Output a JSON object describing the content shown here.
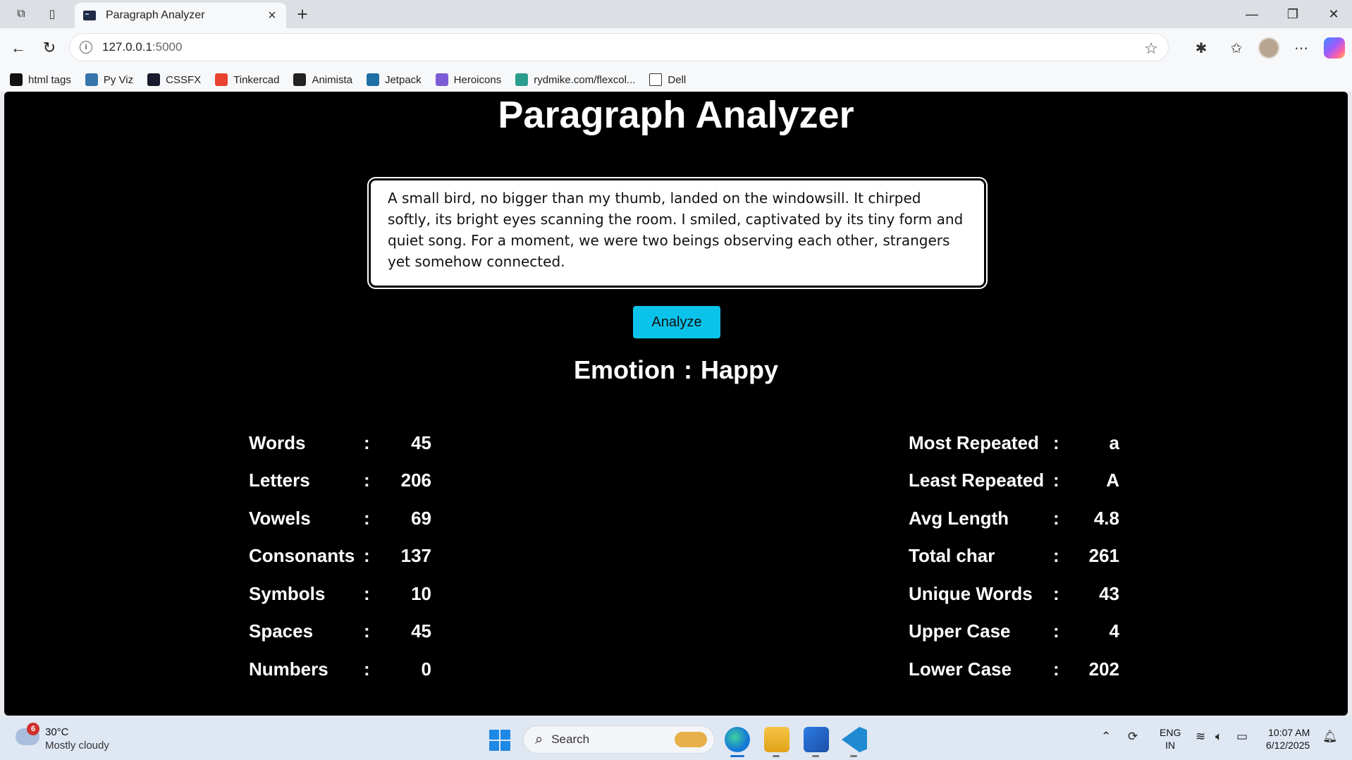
{
  "browser": {
    "tab_title": "Paragraph Analyzer",
    "url_host": "127.0.0.1",
    "url_port": ":5000",
    "bookmarks": [
      {
        "label": "html tags",
        "icon": "m-logo-icon",
        "color": "#111111"
      },
      {
        "label": "Py Viz",
        "icon": "python-icon",
        "color": "#3776ab"
      },
      {
        "label": "CSSFX",
        "icon": "cssfx-icon",
        "color": "#1a1a2e"
      },
      {
        "label": "Tinkercad",
        "icon": "tinkercad-icon",
        "color": "#e8432e"
      },
      {
        "label": "Animista",
        "icon": "animista-icon",
        "color": "#222222"
      },
      {
        "label": "Jetpack",
        "icon": "jetpack-icon",
        "color": "#1d6fa5"
      },
      {
        "label": "Heroicons",
        "icon": "heroicons-icon",
        "color": "#7c5cd6"
      },
      {
        "label": "rydmike.com/flexcol...",
        "icon": "flexcolor-icon",
        "color": "#2a9d8f"
      },
      {
        "label": "Dell",
        "icon": "folder-icon",
        "color": "#ffffff"
      }
    ]
  },
  "page": {
    "title": "Paragraph Analyzer",
    "paragraph": "A small bird, no bigger than my thumb, landed on the windowsill. It chirped softly, its bright eyes scanning the room. I smiled, captivated by its tiny form and quiet song. For a moment, we were two beings observing each other, strangers yet somehow connected. ",
    "analyze_label": "Analyze",
    "emotion_label": "Emotion",
    "emotion_sep": ":",
    "emotion_value": "Happy",
    "separator": ":",
    "left_stats": [
      {
        "label": "Words",
        "value": "45"
      },
      {
        "label": "Letters",
        "value": "206"
      },
      {
        "label": "Vowels",
        "value": "69"
      },
      {
        "label": "Consonants",
        "value": "137"
      },
      {
        "label": "Symbols",
        "value": "10"
      },
      {
        "label": "Spaces",
        "value": "45"
      },
      {
        "label": "Numbers",
        "value": "0"
      }
    ],
    "right_stats": [
      {
        "label": "Most Repeated",
        "value": "a"
      },
      {
        "label": "Least Repeated",
        "value": "A"
      },
      {
        "label": "Avg Length",
        "value": "4.8"
      },
      {
        "label": "Total char",
        "value": "261"
      },
      {
        "label": "Unique Words",
        "value": "43"
      },
      {
        "label": "Upper Case",
        "value": "4"
      },
      {
        "label": "Lower Case",
        "value": "202"
      }
    ],
    "accent_color": "#0bc3ea"
  },
  "taskbar": {
    "weather_badge": "6",
    "weather_temp": "30°C",
    "weather_desc": "Mostly cloudy",
    "search_placeholder": "Search",
    "lang_line1": "ENG",
    "lang_line2": "IN",
    "time": "10:07 AM",
    "date": "6/12/2025"
  }
}
